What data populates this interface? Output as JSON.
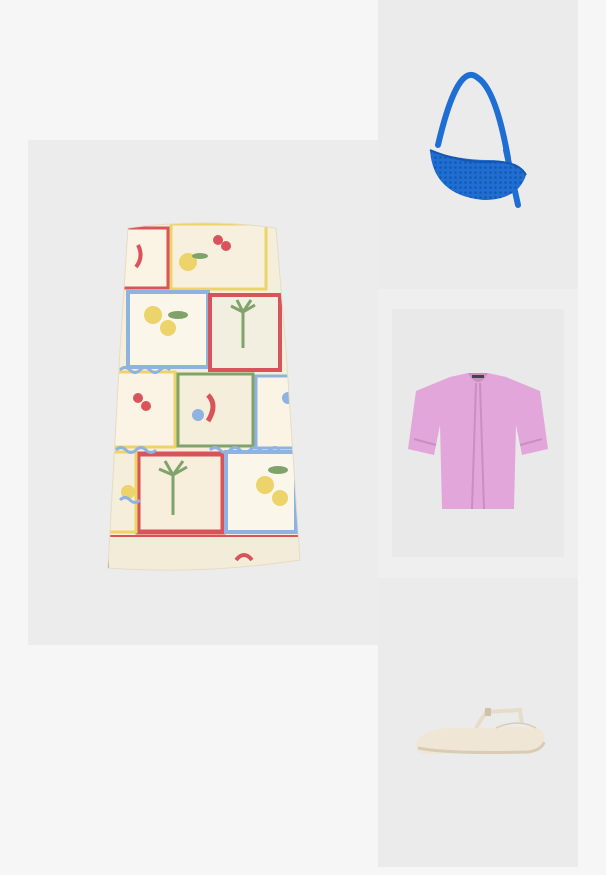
{
  "outfit": {
    "items": [
      {
        "id": "dress",
        "icon": "printed-strapless-mini-dress-image",
        "colors": {
          "base": "#f5eedb",
          "accent_blue": "#8fb3e0",
          "accent_red": "#d9535a",
          "accent_yellow": "#ecd36a",
          "accent_green": "#7fa36b"
        }
      },
      {
        "id": "bag",
        "icon": "blue-mesh-shoulder-bag-image",
        "colors": {
          "main": "#1f6ed4",
          "dark": "#1657ad"
        }
      },
      {
        "id": "cardigan",
        "icon": "pink-short-sleeve-cardigan-image",
        "colors": {
          "main": "#e2a6da",
          "dark": "#c98fc1"
        }
      },
      {
        "id": "shoes",
        "icon": "cream-mary-jane-flats-image",
        "colors": {
          "main": "#efe6d6",
          "sole": "#d9ccb5"
        }
      }
    ],
    "background": "#f6f6f6"
  }
}
